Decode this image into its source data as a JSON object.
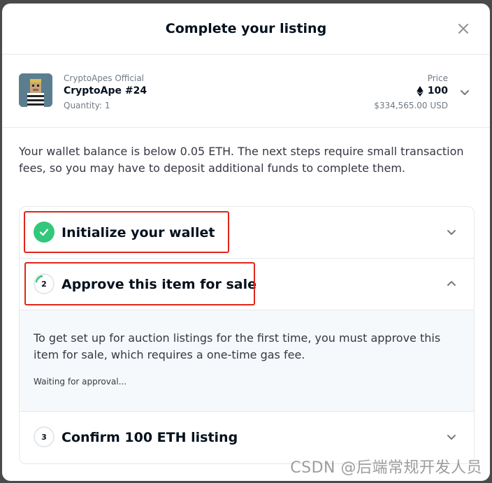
{
  "modal": {
    "title": "Complete your listing"
  },
  "item": {
    "collection": "CryptoApes Official",
    "name": "CryptoApe #24",
    "quantity": "Quantity: 1",
    "price_label": "Price",
    "price_value": "100",
    "price_usd": "$334,565.00 USD",
    "thumbnail_icon": "ape-avatar-icon"
  },
  "notice": "Your wallet balance is below 0.05 ETH. The next steps require small transaction fees, so you may have to deposit additional funds to complete them.",
  "steps": [
    {
      "number": "",
      "label": "Initialize your wallet",
      "status": "complete",
      "expanded": false
    },
    {
      "number": "2",
      "label": "Approve this item for sale",
      "status": "in-progress",
      "expanded": true,
      "description": "To get set up for auction listings for the first time, you must approve this item for sale, which requires a one-time gas fee.",
      "waiting": "Waiting for approval..."
    },
    {
      "number": "3",
      "label": "Confirm 100 ETH listing",
      "status": "pending",
      "expanded": false
    }
  ],
  "watermark": "CSDN @后端常规开发人员",
  "colors": {
    "accent_green": "#34c77b",
    "highlight_red": "#e1251b",
    "panel_bg": "#f5f9fc"
  }
}
